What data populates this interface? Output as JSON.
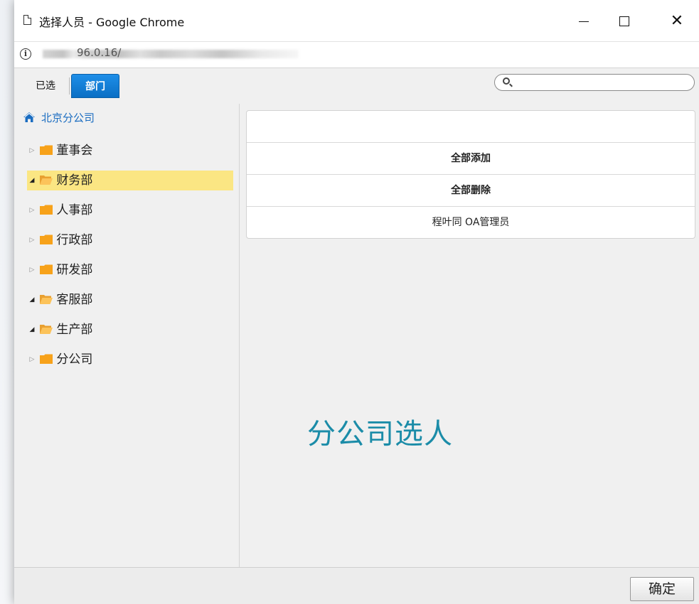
{
  "window": {
    "title": "选择人员 - Google Chrome",
    "minimize_icon": "minimize-icon",
    "maximize_icon": "maximize-icon",
    "close_label": "✕"
  },
  "address": {
    "info_icon": "i",
    "url_visible": "96.0.16/"
  },
  "tabs": [
    {
      "label": "已选",
      "active": false
    },
    {
      "label": "部门",
      "active": true
    }
  ],
  "search": {
    "placeholder": "",
    "value": ""
  },
  "tree": {
    "root_label": "北京分公司",
    "items": [
      {
        "label": "董事会",
        "expanded": false,
        "selected": false
      },
      {
        "label": "财务部",
        "expanded": true,
        "selected": true
      },
      {
        "label": "人事部",
        "expanded": false,
        "selected": false
      },
      {
        "label": "行政部",
        "expanded": false,
        "selected": false
      },
      {
        "label": "研发部",
        "expanded": false,
        "selected": false
      },
      {
        "label": "客服部",
        "expanded": true,
        "selected": false
      },
      {
        "label": "生产部",
        "expanded": true,
        "selected": false
      },
      {
        "label": "分公司",
        "expanded": false,
        "selected": false
      }
    ]
  },
  "content": {
    "rows": [
      {
        "label": "",
        "bold": false
      },
      {
        "label": "全部添加",
        "bold": true
      },
      {
        "label": "全部删除",
        "bold": true
      },
      {
        "label": "程叶同 OA管理员",
        "bold": false
      }
    ],
    "caption": "分公司选人"
  },
  "footer": {
    "ok_label": "确定"
  },
  "colors": {
    "tab_active": "#0a6fc4",
    "tree_selected": "#fbe683",
    "folder": "#f7a21a",
    "folder_open": "#fcc35a",
    "root_link": "#1b6dc1",
    "caption": "#1b8ca8"
  }
}
